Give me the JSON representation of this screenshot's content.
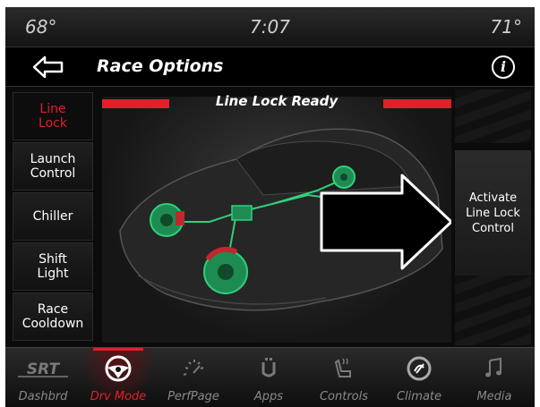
{
  "status": {
    "temp_left": "68°",
    "time": "7:07",
    "temp_right": "71°"
  },
  "header": {
    "title": "Race Options",
    "info_icon": "i"
  },
  "left_nav": [
    {
      "label": "Line\nLock",
      "active": true
    },
    {
      "label": "Launch\nControl",
      "active": false
    },
    {
      "label": "Chiller",
      "active": false
    },
    {
      "label": "Shift\nLight",
      "active": false
    },
    {
      "label": "Race\nCooldown",
      "active": false
    }
  ],
  "main": {
    "banner": "Line Lock Ready"
  },
  "right_panel": {
    "label": "Activate Line Lock Control"
  },
  "bottom_nav": [
    {
      "label": "Dashbrd",
      "icon": "srt-logo-icon",
      "active": false
    },
    {
      "label": "Drv Mode",
      "icon": "steering-wheel-icon",
      "active": true
    },
    {
      "label": "PerfPage",
      "icon": "gauge-icon",
      "active": false
    },
    {
      "label": "Apps",
      "icon": "apps-icon",
      "active": false
    },
    {
      "label": "Controls",
      "icon": "seat-icon",
      "active": false
    },
    {
      "label": "Climate",
      "icon": "climate-icon",
      "active": false
    },
    {
      "label": "Media",
      "icon": "music-note-icon",
      "active": false
    }
  ],
  "colors": {
    "accent": "#e0202a",
    "brake_green": "#2fd07a",
    "background": "#0b0b0b"
  }
}
